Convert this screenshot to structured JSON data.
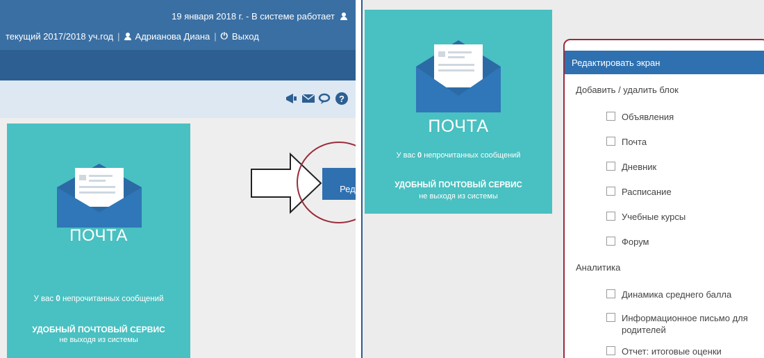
{
  "header": {
    "date_status": "19 января 2018 г. - В системе работает",
    "school_year": "текущий 2017/2018 уч.год",
    "user_name": "Адрианова Диана",
    "logout_label": "Выход"
  },
  "toolbar": {
    "icons": [
      "megaphone-icon",
      "mail-icon",
      "chat-icon",
      "help-icon"
    ]
  },
  "mail_card": {
    "title": "ПОЧТА",
    "unread_prefix": "У вас",
    "unread_count": "0",
    "unread_suffix": "непрочитанных сообщений",
    "promo": "УДОБНЫЙ ПОЧТОВЫЙ СЕРВИС",
    "promo_sub": "не выходя из системы"
  },
  "edit_button_partial": "Реда",
  "menu": {
    "head": "Редактировать экран",
    "section_add": "Добавить / удалить блок",
    "blocks": [
      "Объявления",
      "Почта",
      "Дневник",
      "Расписание",
      "Учебные курсы",
      "Форум"
    ],
    "section_analytics": "Аналитика",
    "analytics": [
      "Динамика среднего балла",
      "Информационное письмо для родителей",
      "Отчет: итоговые оценки"
    ]
  },
  "colors": {
    "header_blue": "#3a6fa3",
    "nav_blue": "#2d5f92",
    "accent_blue": "#2e70b0",
    "card_teal": "#49c0c1",
    "highlight_red": "#9b2b3a"
  }
}
